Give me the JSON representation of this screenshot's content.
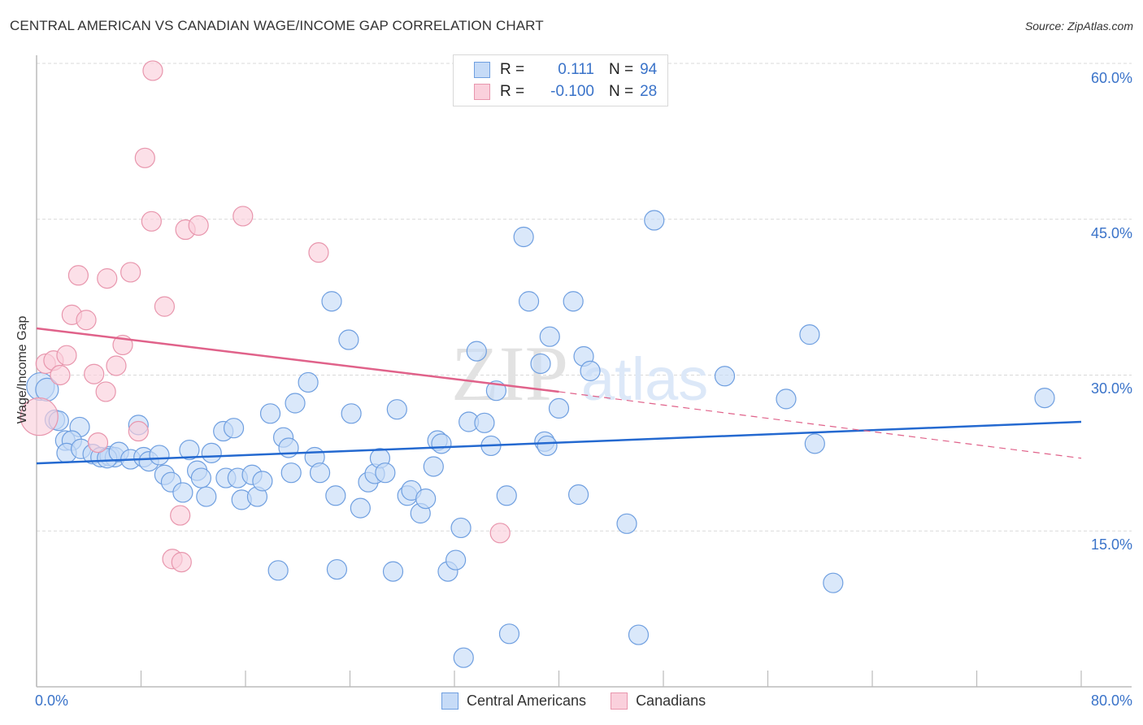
{
  "header": {
    "title": "CENTRAL AMERICAN VS CANADIAN WAGE/INCOME GAP CORRELATION CHART",
    "source": "Source: ZipAtlas.com"
  },
  "legend": {
    "rows": [
      {
        "r_label": "R =",
        "r_value": "0.111",
        "n_label": "N =",
        "n_value": "94"
      },
      {
        "r_label": "R =",
        "r_value": "-0.100",
        "n_label": "N =",
        "n_value": "28"
      }
    ],
    "bottom": [
      "Central Americans",
      "Canadians"
    ]
  },
  "watermark": {
    "zip": "ZIP",
    "atlas": "atlas"
  },
  "colors": {
    "blue_fill": "#c6dbf7",
    "blue_stroke": "#6f9fe0",
    "blue_line": "#2469d0",
    "pink_fill": "#fad0dc",
    "pink_stroke": "#e896ad",
    "pink_line": "#e0628a",
    "tick_text": "#3a73c9"
  },
  "chart_data": {
    "type": "scatter",
    "title": "CENTRAL AMERICAN VS CANADIAN WAGE/INCOME GAP CORRELATION CHART",
    "xlabel": "",
    "ylabel": "Wage/Income Gap",
    "xlim": [
      0,
      80
    ],
    "ylim": [
      0,
      65
    ],
    "x_tick_labels": [
      "0.0%",
      "80.0%"
    ],
    "y_ticks": [
      15,
      30,
      45,
      60
    ],
    "y_tick_labels": [
      "15.0%",
      "30.0%",
      "45.0%",
      "60.0%"
    ],
    "grid": "horizontal-dashed",
    "legend_position": "top-center",
    "series": [
      {
        "name": "Central Americans",
        "R": 0.111,
        "N": 94,
        "trend": {
          "x": [
            0,
            80
          ],
          "y": [
            21.5,
            25.5
          ],
          "style": "solid"
        },
        "points": [
          [
            0.3,
            28.9,
            "L"
          ],
          [
            0.8,
            28.6,
            "M"
          ],
          [
            1.4,
            25.7
          ],
          [
            1.7,
            25.6
          ],
          [
            3.3,
            25.0
          ],
          [
            2.2,
            23.7
          ],
          [
            2.7,
            23.7
          ],
          [
            2.3,
            22.5
          ],
          [
            3.4,
            22.9
          ],
          [
            4.3,
            22.4
          ],
          [
            4.9,
            22.1
          ],
          [
            5.6,
            22.2
          ],
          [
            6.0,
            22.1
          ],
          [
            5.4,
            22.0
          ],
          [
            6.3,
            22.6
          ],
          [
            7.2,
            21.9
          ],
          [
            8.2,
            22.1
          ],
          [
            8.6,
            21.7
          ],
          [
            7.8,
            25.2
          ],
          [
            9.4,
            22.3
          ],
          [
            9.8,
            20.4
          ],
          [
            10.3,
            19.7
          ],
          [
            11.7,
            22.8
          ],
          [
            11.2,
            18.7
          ],
          [
            12.3,
            20.8
          ],
          [
            12.6,
            20.1
          ],
          [
            13.4,
            22.5
          ],
          [
            13.0,
            18.3
          ],
          [
            14.3,
            24.6
          ],
          [
            15.1,
            24.9
          ],
          [
            14.5,
            20.1
          ],
          [
            15.4,
            20.1
          ],
          [
            15.7,
            18.0
          ],
          [
            16.5,
            20.4
          ],
          [
            16.9,
            18.3
          ],
          [
            17.3,
            19.8
          ],
          [
            17.9,
            26.3
          ],
          [
            18.9,
            24.0
          ],
          [
            19.3,
            23.0
          ],
          [
            19.8,
            27.3
          ],
          [
            19.5,
            20.6
          ],
          [
            20.8,
            29.3
          ],
          [
            21.3,
            22.1
          ],
          [
            21.7,
            20.6
          ],
          [
            22.6,
            37.1
          ],
          [
            23.9,
            33.4
          ],
          [
            24.1,
            26.3
          ],
          [
            22.9,
            18.4
          ],
          [
            24.8,
            17.2
          ],
          [
            25.4,
            19.7
          ],
          [
            25.9,
            20.5
          ],
          [
            26.3,
            22.0
          ],
          [
            26.7,
            20.6
          ],
          [
            27.6,
            26.7
          ],
          [
            28.4,
            18.4
          ],
          [
            28.7,
            18.9
          ],
          [
            29.4,
            16.7
          ],
          [
            29.8,
            18.1
          ],
          [
            30.4,
            21.2
          ],
          [
            30.7,
            23.7
          ],
          [
            31.0,
            23.4
          ],
          [
            32.5,
            15.3
          ],
          [
            33.1,
            25.5
          ],
          [
            33.7,
            32.3
          ],
          [
            34.3,
            25.4
          ],
          [
            34.8,
            23.2
          ],
          [
            35.2,
            28.5
          ],
          [
            36.0,
            18.4
          ],
          [
            37.3,
            43.3
          ],
          [
            37.7,
            37.1
          ],
          [
            38.6,
            31.1
          ],
          [
            38.9,
            23.6
          ],
          [
            39.1,
            23.2
          ],
          [
            39.3,
            33.7
          ],
          [
            40.0,
            26.8
          ],
          [
            41.1,
            37.1
          ],
          [
            41.5,
            18.5
          ],
          [
            41.9,
            31.8
          ],
          [
            42.4,
            30.4
          ],
          [
            45.2,
            15.7
          ],
          [
            47.3,
            44.9
          ],
          [
            52.7,
            29.9
          ],
          [
            57.4,
            27.7
          ],
          [
            59.2,
            33.9
          ],
          [
            59.6,
            23.4
          ],
          [
            61.0,
            10.0
          ],
          [
            77.2,
            27.8
          ],
          [
            18.5,
            11.2
          ],
          [
            23.0,
            11.3
          ],
          [
            27.3,
            11.1
          ],
          [
            31.5,
            11.1
          ],
          [
            32.1,
            12.2
          ],
          [
            36.2,
            5.1
          ],
          [
            46.1,
            5.0
          ],
          [
            32.7,
            2.8
          ]
        ]
      },
      {
        "name": "Canadians",
        "R": -0.1,
        "N": 28,
        "trend": {
          "x": [
            0,
            40
          ],
          "y": [
            34.5,
            28.4
          ],
          "style": "solid",
          "extended": {
            "x": [
              40,
              80
            ],
            "y": [
              28.4,
              22.0
            ],
            "style": "dashed"
          }
        },
        "points": [
          [
            0.2,
            26.0,
            "XL"
          ],
          [
            0.7,
            31.1
          ],
          [
            1.3,
            31.4
          ],
          [
            1.8,
            30.0
          ],
          [
            2.3,
            31.9
          ],
          [
            2.7,
            35.8
          ],
          [
            3.2,
            39.6
          ],
          [
            3.8,
            35.3
          ],
          [
            4.4,
            30.1
          ],
          [
            4.7,
            23.5
          ],
          [
            5.3,
            28.4
          ],
          [
            5.4,
            39.3
          ],
          [
            6.1,
            30.9
          ],
          [
            6.6,
            32.9
          ],
          [
            7.2,
            39.9
          ],
          [
            7.8,
            24.6
          ],
          [
            8.3,
            50.9
          ],
          [
            8.8,
            44.8
          ],
          [
            8.9,
            59.3
          ],
          [
            9.8,
            36.6
          ],
          [
            11.0,
            16.5
          ],
          [
            11.4,
            44.0
          ],
          [
            10.4,
            12.3
          ],
          [
            11.1,
            12.0
          ],
          [
            12.4,
            44.4
          ],
          [
            15.8,
            45.3
          ],
          [
            21.6,
            41.8
          ],
          [
            35.5,
            14.8
          ]
        ]
      }
    ]
  }
}
